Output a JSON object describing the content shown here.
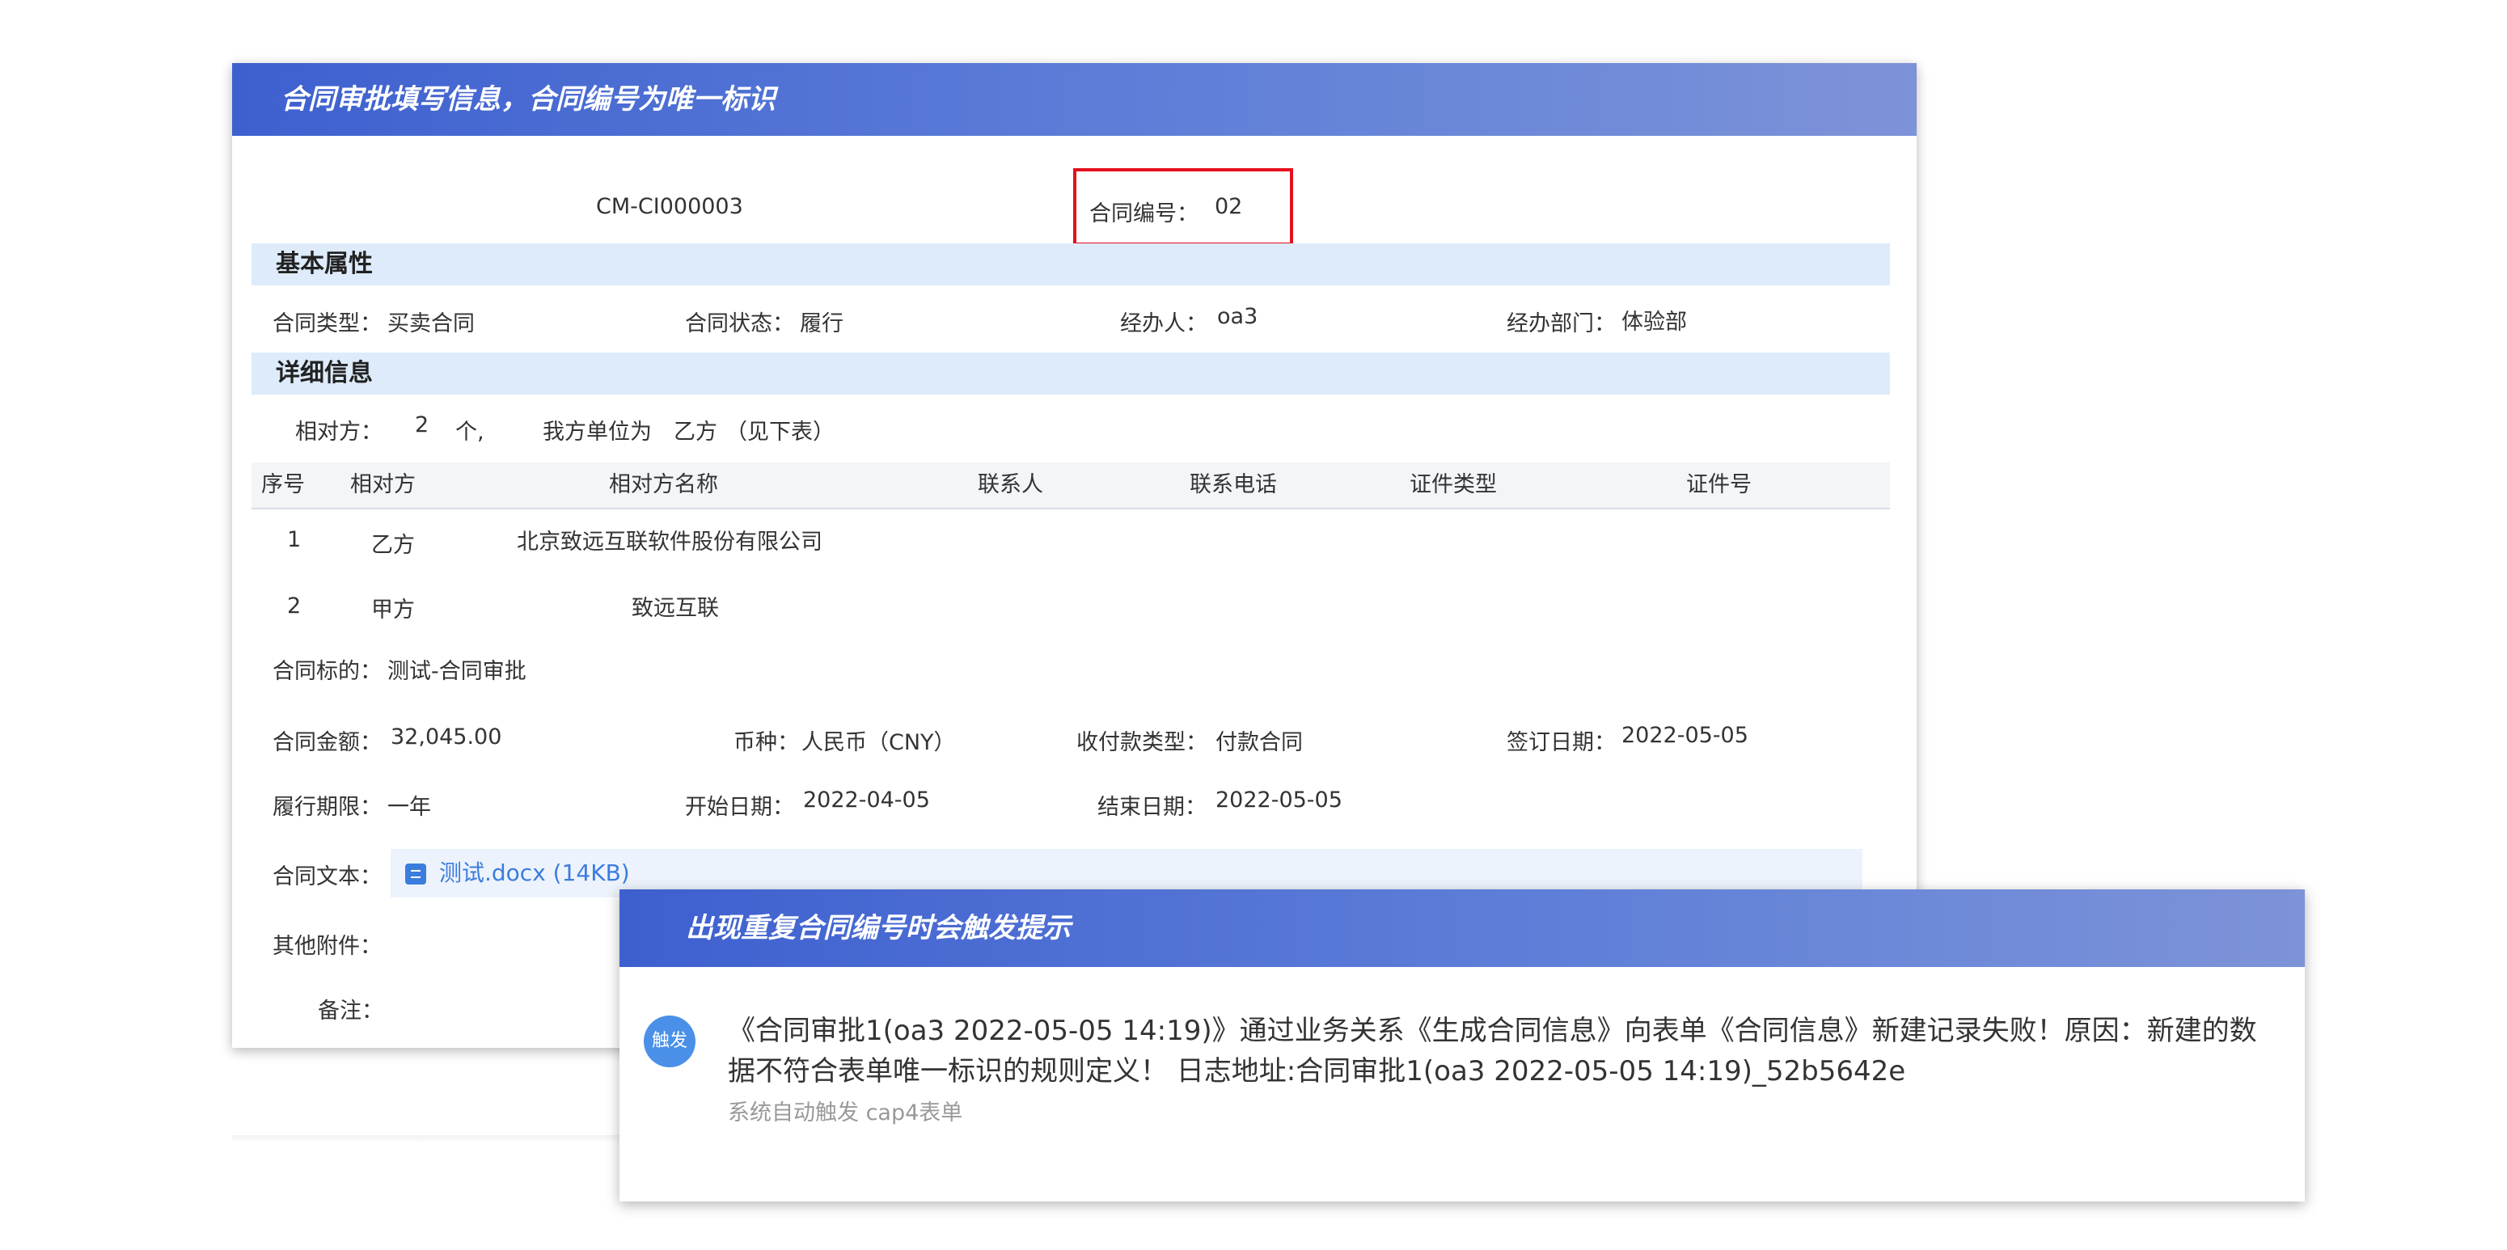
{
  "form_card": {
    "header_title": "合同审批填写信息，合同编号为唯一标识",
    "contract_code": "CM-CI000003",
    "contract_no_label": "合同编号：",
    "contract_no_value": "02",
    "basic_section": "基本属性",
    "basic": {
      "type_label": "合同类型：",
      "type_value": "买卖合同",
      "status_label": "合同状态：",
      "status_value": "履行",
      "handler_label": "经办人：",
      "handler_value": "oa3",
      "dept_label": "经办部门：",
      "dept_value": "体验部"
    },
    "detail_section": "详细信息",
    "counterparty_summary": {
      "label": "相对方：",
      "count": "2",
      "unit": "个,",
      "our_unit_label": "我方单位为",
      "our_unit_value": "乙方",
      "note": "（见下表）"
    },
    "table": {
      "headers": [
        "序号",
        "相对方",
        "相对方名称",
        "联系人",
        "联系电话",
        "证件类型",
        "证件号"
      ],
      "rows": [
        {
          "no": "1",
          "party": "乙方",
          "name": "北京致远互联软件股份有限公司"
        },
        {
          "no": "2",
          "party": "甲方",
          "name": "致远互联"
        }
      ]
    },
    "subject_label": "合同标的：",
    "subject_value": "测试-合同审批",
    "amount_label": "合同金额：",
    "amount_value": "32,045.00",
    "currency_label": "币种：",
    "currency_value": "人民币（CNY）",
    "payment_label": "收付款类型：",
    "payment_value": "付款合同",
    "sign_date_label": "签订日期：",
    "sign_date_value": "2022-05-05",
    "term_label": "履行期限：",
    "term_value": "一年",
    "start_label": "开始日期：",
    "start_value": "2022-04-05",
    "end_label": "结束日期：",
    "end_value": "2022-05-05",
    "text_label": "合同文本：",
    "attachment_name": "测试.docx (14KB)",
    "attachment_icon": "document-icon",
    "other_attach_label": "其他附件：",
    "remark_label": "备注："
  },
  "notice_card": {
    "header_title": "出现重复合同编号时会触发提示",
    "avatar_text": "触发",
    "message": "《合同审批1(oa3 2022-05-05 14:19)》通过业务关系《生成合同信息》向表单《合同信息》新建记录失败！原因：新建的数据不符合表单唯一标识的规则定义！ 日志地址:合同审批1(oa3 2022-05-05 14:19)_52b5642e",
    "sub": "系统自动触发 cap4表单"
  },
  "colors": {
    "header_gradient_start": "#3e60cf",
    "header_gradient_end": "#7d93d8",
    "section_band": "#ddebfa",
    "highlight_border": "#e5101f",
    "link": "#3b7ddd",
    "avatar": "#4a90e8"
  }
}
